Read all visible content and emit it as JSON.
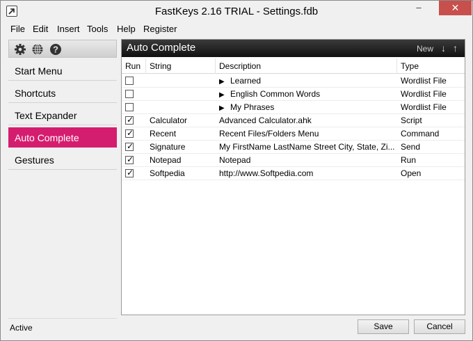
{
  "window": {
    "title": "FastKeys 2.16 TRIAL - Settings.fdb",
    "minimize": "–",
    "maximize": "□",
    "close": "✕"
  },
  "menu": [
    "File",
    "Edit",
    "Insert",
    "Tools",
    "Help",
    "Register"
  ],
  "toolbar_icons": [
    "gear-icon",
    "globe-icon",
    "help-icon"
  ],
  "nav": {
    "items": [
      "Start Menu",
      "Shortcuts",
      "Text Expander",
      "Auto Complete",
      "Gestures"
    ],
    "active": "Auto Complete"
  },
  "status": "Active",
  "panel": {
    "title": "Auto Complete",
    "new_label": "New",
    "down_arrow": "↓",
    "up_arrow": "↑",
    "columns": [
      "Run",
      "String",
      "Description",
      "Type"
    ],
    "rows": [
      {
        "checked": false,
        "string": "",
        "description": "Learned",
        "expandable": true,
        "type": "Wordlist File"
      },
      {
        "checked": false,
        "string": "",
        "description": "English Common Words",
        "expandable": true,
        "type": "Wordlist File"
      },
      {
        "checked": false,
        "string": "",
        "description": "My Phrases",
        "expandable": true,
        "type": "Wordlist File"
      },
      {
        "checked": true,
        "string": "Calculator",
        "description": "Advanced Calculator.ahk",
        "expandable": false,
        "type": "Script"
      },
      {
        "checked": true,
        "string": "Recent",
        "description": "Recent Files/Folders Menu",
        "expandable": false,
        "type": "Command"
      },
      {
        "checked": true,
        "string": "Signature",
        "description": "My FirstName LastName Street City, State, Zi...",
        "expandable": false,
        "type": "Send"
      },
      {
        "checked": true,
        "string": "Notepad",
        "description": "Notepad",
        "expandable": false,
        "type": "Run"
      },
      {
        "checked": true,
        "string": "Softpedia",
        "description": "http://www.Softpedia.com",
        "expandable": false,
        "type": "Open"
      }
    ]
  },
  "buttons": {
    "save": "Save",
    "cancel": "Cancel"
  },
  "colors": {
    "accent": "#d51d6f",
    "header_bg": "#1e1e1e",
    "close_btn": "#c7504d"
  }
}
